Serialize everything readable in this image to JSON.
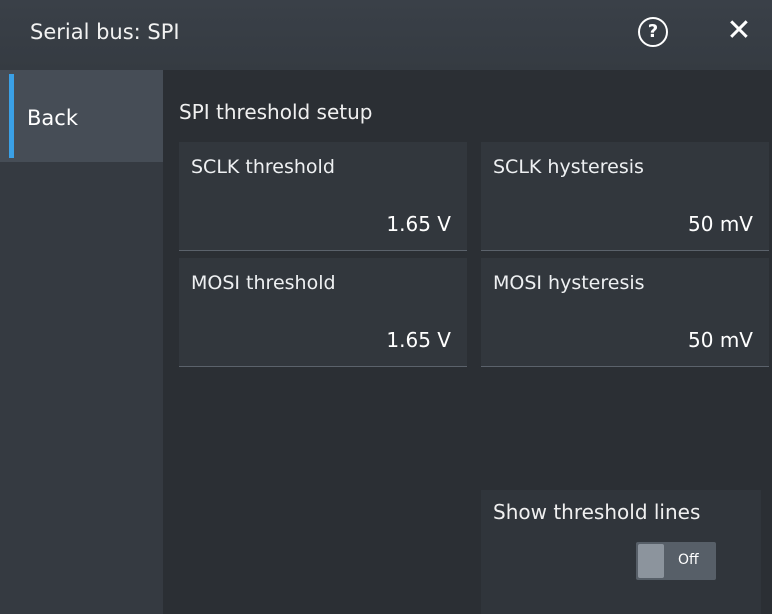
{
  "window": {
    "title": "Serial bus: SPI",
    "help_label": "?",
    "close_label": "✕"
  },
  "sidebar": {
    "back_label": "Back"
  },
  "main": {
    "section_title": "SPI threshold setup",
    "fields": [
      {
        "label": "SCLK threshold",
        "value": "1.65 V"
      },
      {
        "label": "SCLK hysteresis",
        "value": "50 mV"
      },
      {
        "label": "MOSI threshold",
        "value": "1.65 V"
      },
      {
        "label": "MOSI hysteresis",
        "value": "50 mV"
      }
    ],
    "threshold_lines": {
      "label": "Show threshold lines",
      "state": "Off"
    }
  },
  "colors": {
    "accent": "#3aa0e6",
    "background": "#2b2f34",
    "sidebar": "#353a41"
  },
  "icons": {
    "help": "help-icon",
    "close": "close-icon"
  }
}
